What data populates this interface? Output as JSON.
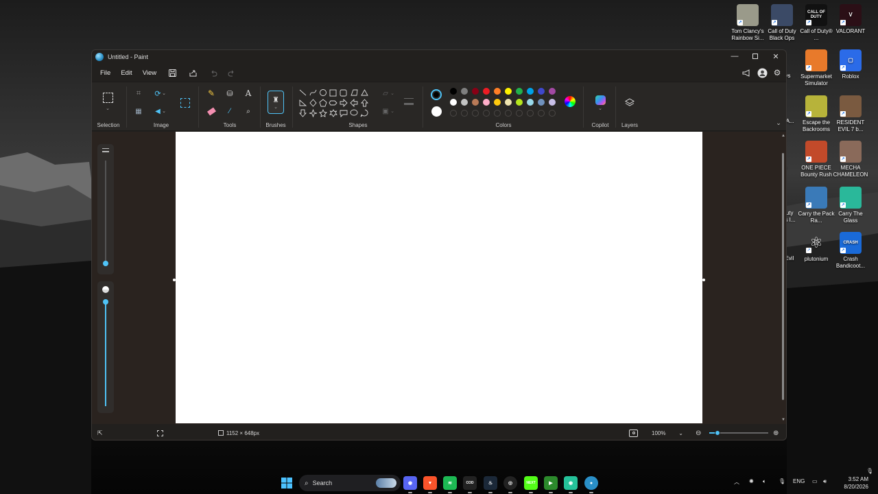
{
  "window": {
    "title": "Untitled - Paint",
    "controls": [
      "minimize",
      "maximize",
      "close"
    ]
  },
  "menu": {
    "file": "File",
    "edit": "Edit",
    "view": "View"
  },
  "ribbon": {
    "groups": {
      "selection": "Selection",
      "image": "Image",
      "tools": "Tools",
      "brushes": "Brushes",
      "shapes": "Shapes",
      "colors": "Colors",
      "copilot": "Copilot",
      "layers": "Layers"
    },
    "palette": {
      "row1": [
        "#000000",
        "#7f7f7f",
        "#880015",
        "#ed1c24",
        "#ff7f27",
        "#fff200",
        "#22b14c",
        "#00a2e8",
        "#3f48cc",
        "#a349a4"
      ],
      "row2": [
        "#ffffff",
        "#c3c3c3",
        "#b97a57",
        "#ffaec9",
        "#ffc90e",
        "#efe4b0",
        "#b5e61d",
        "#99d9ea",
        "#7092be",
        "#c8bfe7"
      ]
    },
    "primary_color": "#000000",
    "secondary_color": "#ffffff"
  },
  "status": {
    "canvas_size": "1152 × 648px",
    "zoom": "100%"
  },
  "desktop_icons": [
    {
      "label": "Tom Clancy's Rainbow Si...",
      "color": "#9a9a8a",
      "glyph": ""
    },
    {
      "label": "Call of Duty Black Ops",
      "color": "#3b4a66",
      "glyph": ""
    },
    {
      "label": "Call of Duty® ...",
      "color": "#111111",
      "glyph": "CALL OF DUTY"
    },
    {
      "label": "VALORANT",
      "color": "#2b0f16",
      "glyph": "V"
    },
    {
      "label": "Supermarket Simulator",
      "color": "#e87a2b",
      "glyph": ""
    },
    {
      "label": "Roblox",
      "color": "#2b6be8",
      "glyph": "▢"
    },
    {
      "label": "Escape the Backrooms",
      "color": "#b7b33a",
      "glyph": ""
    },
    {
      "label": "RESIDENT EVIL 7 b...",
      "color": "#7a5a40",
      "glyph": ""
    },
    {
      "label": "ONE PIECE Bounty Rush",
      "color": "#c24a2a",
      "glyph": ""
    },
    {
      "label": "MECHA CHAMELEON",
      "color": "#8a6a5a",
      "glyph": ""
    },
    {
      "label": "Carry the Pack Ra...",
      "color": "#3a7ab8",
      "glyph": ""
    },
    {
      "label": "Carry The Glass",
      "color": "#2ab89a",
      "glyph": ""
    },
    {
      "label": "plutonium",
      "color": "transparent",
      "glyph": "⚛"
    },
    {
      "label": "Crash Bandicoot...",
      "color": "#1a6ad8",
      "glyph": "CRASH"
    }
  ],
  "partial_icons": [
    "ays",
    "NA...",
    "o",
    "re",
    "Duty",
    "ps I...",
    "t Evil",
    "e"
  ],
  "taskbar": {
    "search_placeholder": "Search",
    "apps": [
      {
        "name": "discord",
        "color": "#5865f2",
        "glyph": "◉"
      },
      {
        "name": "brave",
        "color": "#fb542b",
        "glyph": "▼"
      },
      {
        "name": "spotify",
        "color": "#1db954",
        "glyph": "≋"
      },
      {
        "name": "call-of-duty",
        "color": "#222222",
        "glyph": "COD"
      },
      {
        "name": "steam",
        "color": "#1b2838",
        "glyph": "♨"
      },
      {
        "name": "chrome",
        "color": "#222222",
        "glyph": "◎"
      },
      {
        "name": "kick",
        "color": "#53fc18",
        "glyph": "NEXT"
      },
      {
        "name": "game",
        "color": "#2c8a2c",
        "glyph": "▶"
      },
      {
        "name": "paint-app",
        "color": "#25c29a",
        "glyph": "◉"
      },
      {
        "name": "paint",
        "color": "#2a8fc7",
        "glyph": "●"
      }
    ],
    "lang": "ENG",
    "time": "3:52 AM",
    "date": "8/20/2026"
  }
}
